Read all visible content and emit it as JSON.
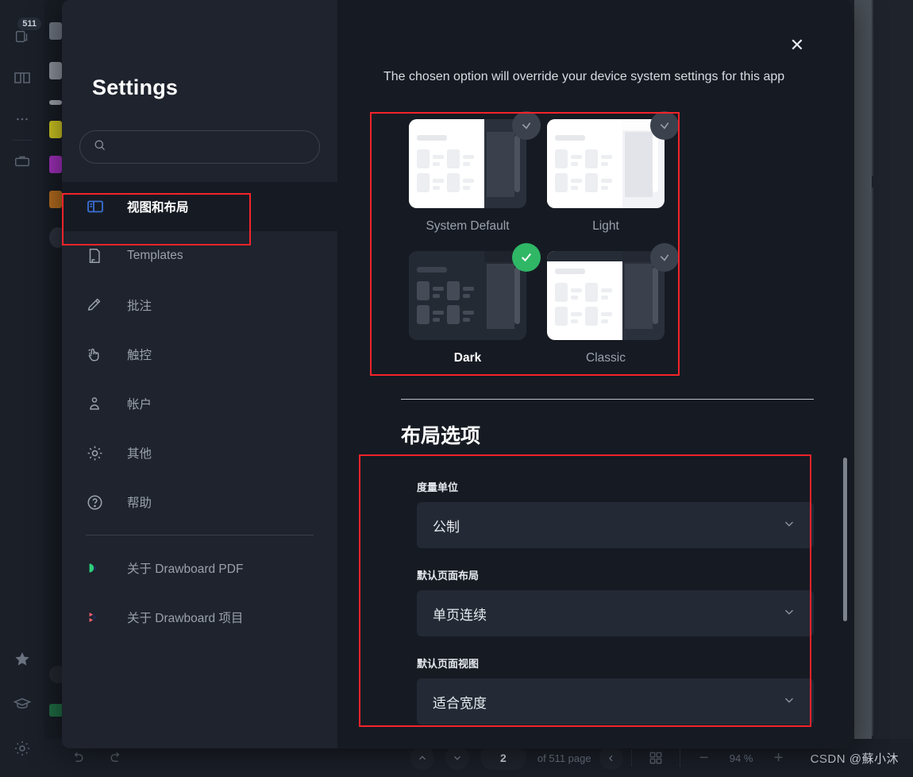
{
  "app": {
    "left_rail": [
      {
        "name": "pages-icon",
        "badge": "511"
      },
      {
        "name": "book-icon",
        "badge": ""
      },
      {
        "name": "more-dots-icon",
        "badge": ""
      },
      {
        "name": "briefcase-icon",
        "badge": ""
      }
    ],
    "left_rail_bottom": [
      {
        "name": "star-icon"
      },
      {
        "name": "graduation-cap-icon"
      },
      {
        "name": "gear-icon"
      }
    ]
  },
  "bottom_toolbar": {
    "undo_label": "undo-icon",
    "redo_label": "redo-icon",
    "page_up_label": "chevron-up-icon",
    "page_down_label": "chevron-down-icon",
    "current_page": "2",
    "page_total_text": "of 511 page",
    "collapse_label": "chevron-left-icon",
    "grid_view_label": "grid-view-icon",
    "zoom_out_label": "−",
    "zoom_level": "94 %",
    "zoom_in_label": "+",
    "watermark": "CSDN @蘇小沐"
  },
  "modal": {
    "title": "Settings",
    "close_label": "✕",
    "search": {
      "value": "",
      "placeholder": ""
    },
    "nav": {
      "items": [
        {
          "label": "视图和布局",
          "icon": "layout-icon",
          "active": true
        },
        {
          "label": "Templates",
          "icon": "template-icon",
          "active": false
        },
        {
          "label": "批注",
          "icon": "pencil-icon",
          "active": false
        },
        {
          "label": "触控",
          "icon": "touch-icon",
          "active": false
        },
        {
          "label": "帐户",
          "icon": "account-icon",
          "active": false
        },
        {
          "label": "其他",
          "icon": "gear-icon",
          "active": false
        },
        {
          "label": "帮助",
          "icon": "help-icon",
          "active": false
        }
      ],
      "footer_items": [
        {
          "label": "关于 Drawboard PDF",
          "icon": "drawboard-pdf-logo"
        },
        {
          "label": "关于 Drawboard 项目",
          "icon": "drawboard-projects-logo"
        }
      ]
    },
    "content": {
      "override_text": "The chosen option will override your device system settings for this app",
      "themes": [
        {
          "label": "System Default",
          "selected": false,
          "variant": "system"
        },
        {
          "label": "Light",
          "selected": false,
          "variant": "light"
        },
        {
          "label": "Dark",
          "selected": true,
          "variant": "dark"
        },
        {
          "label": "Classic",
          "selected": false,
          "variant": "classic"
        }
      ],
      "layout_section_title": "布局选项",
      "fields": [
        {
          "label": "度量单位",
          "value": "公制"
        },
        {
          "label": "默认页面布局",
          "value": "单页连续"
        },
        {
          "label": "默认页面视图",
          "value": "适合宽度"
        }
      ]
    }
  },
  "colors": {
    "accent_red_highlight": "#f5232b",
    "accent_blue": "#3b6fd4",
    "accent_green": "#2fb766",
    "modal_bg": "#161b23",
    "sidebar_bg": "#1e232d"
  }
}
